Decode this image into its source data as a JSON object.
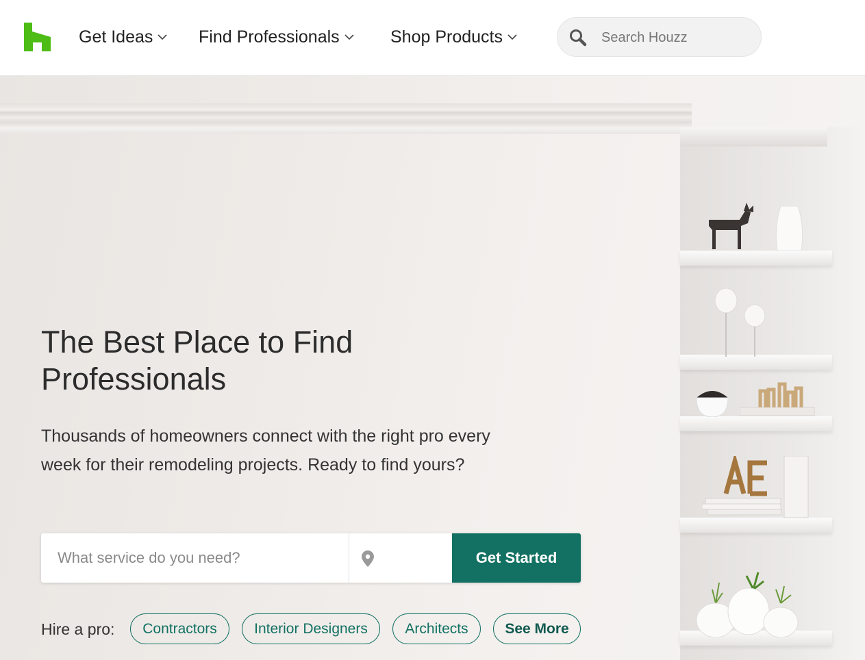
{
  "header": {
    "nav": [
      {
        "label": "Get Ideas"
      },
      {
        "label": "Find Professionals"
      },
      {
        "label": "Shop Products"
      }
    ],
    "search_placeholder": "Search Houzz",
    "logo_color": "#4dbc15"
  },
  "hero": {
    "title": "The Best Place to Find Professionals",
    "subtitle": "Thousands of homeowners connect with the right pro every week for their remodeling projects. Ready to find yours?",
    "service_placeholder": "What service do you need?",
    "cta_label": "Get Started",
    "accent_color": "#127162",
    "hire_label": "Hire a pro:",
    "chips": [
      {
        "label": "Contractors"
      },
      {
        "label": "Interior Designers"
      },
      {
        "label": "Architects"
      },
      {
        "label": "See More"
      }
    ]
  }
}
